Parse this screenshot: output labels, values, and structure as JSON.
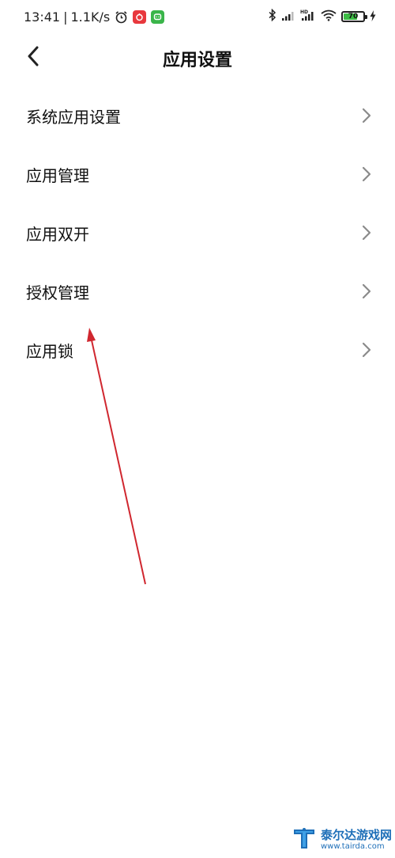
{
  "status_bar": {
    "time": "13:41",
    "separator": "|",
    "net_speed": "1.1K/s",
    "battery_level": "70",
    "battery_fraction": 0.7,
    "icons": [
      "alarm-icon",
      "app-notification-icon",
      "message-app-icon",
      "bluetooth-icon",
      "signal-icon",
      "hd-signal-icon",
      "wifi-icon",
      "battery-icon",
      "charging-icon"
    ]
  },
  "header": {
    "title": "应用设置",
    "back_icon": "back-arrow-icon"
  },
  "menu": {
    "items": [
      {
        "label": "系统应用设置"
      },
      {
        "label": "应用管理"
      },
      {
        "label": "应用双开"
      },
      {
        "label": "授权管理"
      },
      {
        "label": "应用锁"
      }
    ]
  },
  "watermark": {
    "name": "泰尔达游戏网",
    "url": "www.tairda.com"
  },
  "colors": {
    "annotation_arrow": "#d0272f",
    "battery_fill": "#3dbd45",
    "chevron": "#8a8a8a",
    "watermark": "#1e6fb8",
    "app_badge_red": "#e8383d",
    "app_badge_green": "#3ab54a"
  }
}
